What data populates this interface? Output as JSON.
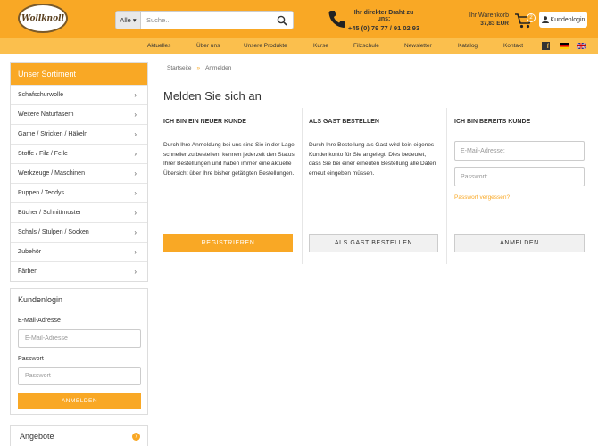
{
  "header": {
    "logo_text": "Wollknoll",
    "search_category": "Alle",
    "search_placeholder": "Suche...",
    "phone_label": "Ihr direkter Draht zu uns:",
    "phone_number": "+45 (0) 79 77 / 91 02 93",
    "cart_label": "Ihr Warenkorb",
    "cart_total": "37,83 EUR",
    "cart_count": "2",
    "login_label": "Kundenlogin",
    "accent_color": "#f9a825"
  },
  "nav": {
    "items": [
      "Aktuelles",
      "Über uns",
      "Unsere Produkte",
      "Kurse",
      "Filzschule",
      "Newsletter",
      "Katalog",
      "Kontakt"
    ]
  },
  "sidebar": {
    "title": "Unser Sortiment",
    "items": [
      "Schafschurwolle",
      "Weitere Naturfasern",
      "Garne / Stricken / Häkeln",
      "Stoffe / Filz / Felle",
      "Werkzeuge / Maschinen",
      "Puppen / Teddys",
      "Bücher / Schnittmuster",
      "Schals / Stulpen / Socken",
      "Zubehör",
      "Färben"
    ],
    "login": {
      "title": "Kundenlogin",
      "email_label": "E-Mail-Adresse",
      "email_placeholder": "E-Mail-Adresse",
      "password_label": "Passwort",
      "password_placeholder": "Passwort",
      "submit_label": "ANMELDEN"
    },
    "offers_title": "Angebote"
  },
  "main": {
    "breadcrumb": [
      "Startseite",
      "Anmelden"
    ],
    "title": "Melden Sie sich an",
    "new_customer": {
      "heading": "ICH BIN EIN NEUER KUNDE",
      "text": "Durch Ihre Anmeldung bei uns sind Sie in der Lage schneller zu bestellen, kennen jederzeit den Status Ihrer Bestellungen und haben immer eine aktuelle Übersicht über Ihre bisher getätigten Bestellungen.",
      "button": "REGISTRIEREN"
    },
    "guest": {
      "heading": "ALS GAST BESTELLEN",
      "text": "Durch Ihre Bestellung als Gast wird kein eigenes Kundenkonto für Sie angelegt. Dies bedeutet, dass Sie bei einer erneuten Bestellung alle Daten erneut eingeben müssen.",
      "button": "ALS GAST BESTELLEN"
    },
    "existing": {
      "heading": "ICH BIN BEREITS KUNDE",
      "email_placeholder": "E-Mail-Adresse:",
      "password_placeholder": "Passwort:",
      "forgot": "Passwort vergessen?",
      "button": "ANMELDEN"
    }
  }
}
